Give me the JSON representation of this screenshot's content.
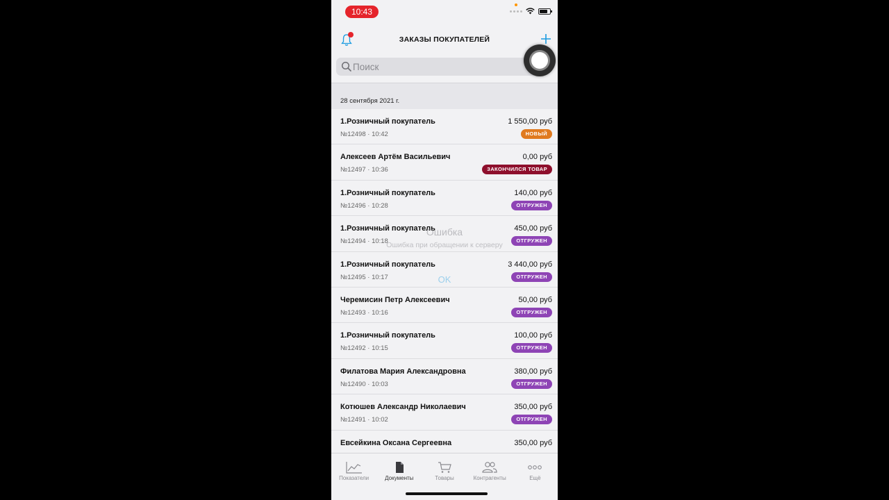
{
  "status_bar": {
    "time": "10:43"
  },
  "header": {
    "title": "ЗАКАЗЫ ПОКУПАТЕЛЕЙ"
  },
  "search": {
    "placeholder": "Поиск"
  },
  "section": {
    "date": "28 сентября 2021 г."
  },
  "orders": [
    {
      "customer": "1.Розничный покупатель",
      "number": "№12498",
      "time": "10:42",
      "amount": "1 550,00 руб",
      "status": "НОВЫЙ",
      "status_color": "#e07a1f"
    },
    {
      "customer": "Алексеев Артём Васильевич",
      "number": "№12497",
      "time": "10:36",
      "amount": "0,00 руб",
      "status": "ЗАКОНЧИЛСЯ ТОВАР",
      "status_color": "#8e0f2c"
    },
    {
      "customer": "1.Розничный покупатель",
      "number": "№12496",
      "time": "10:28",
      "amount": "140,00 руб",
      "status": "ОТГРУЖЕН",
      "status_color": "#8e44b5"
    },
    {
      "customer": "1.Розничный покупатель",
      "number": "№12494",
      "time": "10:18",
      "amount": "450,00 руб",
      "status": "ОТГРУЖЕН",
      "status_color": "#8e44b5"
    },
    {
      "customer": "1.Розничный покупатель",
      "number": "№12495",
      "time": "10:17",
      "amount": "3 440,00 руб",
      "status": "ОТГРУЖЕН",
      "status_color": "#8e44b5"
    },
    {
      "customer": "Черемисин Петр Алексеевич",
      "number": "№12493",
      "time": "10:16",
      "amount": "50,00 руб",
      "status": "ОТГРУЖЕН",
      "status_color": "#8e44b5"
    },
    {
      "customer": "1.Розничный покупатель",
      "number": "№12492",
      "time": "10:15",
      "amount": "100,00 руб",
      "status": "ОТГРУЖЕН",
      "status_color": "#8e44b5"
    },
    {
      "customer": "Филатова Мария Александровна",
      "number": "№12490",
      "time": "10:03",
      "amount": "380,00 руб",
      "status": "ОТГРУЖЕН",
      "status_color": "#8e44b5"
    },
    {
      "customer": "Котюшев Александр Николаевич",
      "number": "№12491",
      "time": "10:02",
      "amount": "350,00 руб",
      "status": "ОТГРУЖЕН",
      "status_color": "#8e44b5"
    },
    {
      "customer": "Евсейкина Оксана Сергеевна",
      "number": "",
      "time": "",
      "amount": "350,00 руб",
      "status": "",
      "status_color": "#8e44b5"
    }
  ],
  "alert": {
    "title": "Ошибка",
    "message": "Ошибка при обращении к серверу",
    "ok": "OK"
  },
  "tabbar": {
    "items": [
      {
        "label": "Показатели",
        "icon": "chart-icon"
      },
      {
        "label": "Документы",
        "icon": "document-icon",
        "active": true
      },
      {
        "label": "Товары",
        "icon": "cart-icon"
      },
      {
        "label": "Контрагенты",
        "icon": "people-icon"
      },
      {
        "label": "Ещё",
        "icon": "more-icon"
      }
    ]
  },
  "colors": {
    "accent": "#1a9be0",
    "notification": "#e5242b",
    "shipped": "#8e44b5",
    "new": "#e07a1f",
    "out_of_stock": "#8e0f2c"
  }
}
